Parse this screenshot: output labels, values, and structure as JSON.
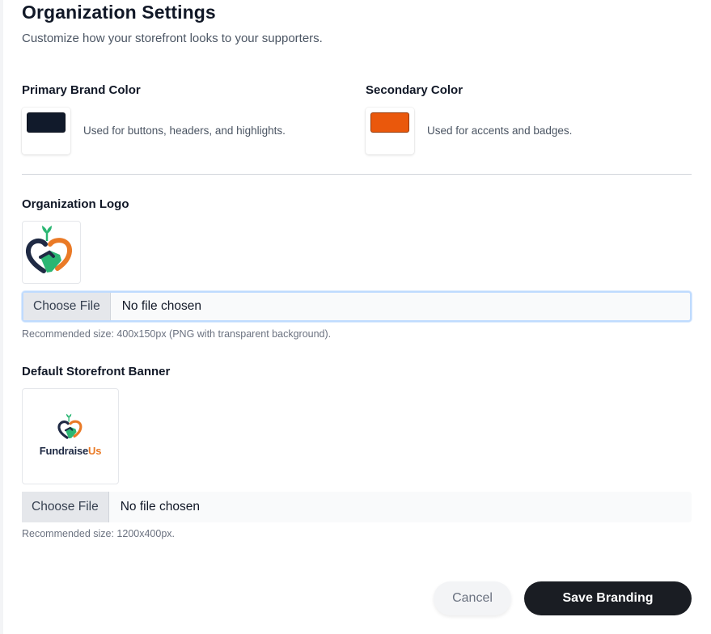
{
  "header": {
    "title": "Organization Settings",
    "subtitle": "Customize how your storefront looks to your supporters."
  },
  "colors": {
    "primary": {
      "label": "Primary Brand Color",
      "value": "#111a2b",
      "help": "Used for buttons, headers, and highlights."
    },
    "secondary": {
      "label": "Secondary Color",
      "value": "#ea580c",
      "help": "Used for accents and badges."
    }
  },
  "logo": {
    "label": "Organization Logo",
    "button_label": "Choose File",
    "status": "No file chosen",
    "help": "Recommended size: 400x150px (PNG with transparent background)."
  },
  "banner": {
    "label": "Default Storefront Banner",
    "brand_part1": "Fundraise",
    "brand_part2": "Us",
    "button_label": "Choose File",
    "status": "No file chosen",
    "help": "Recommended size: 1200x400px."
  },
  "actions": {
    "cancel_label": "Cancel",
    "save_label": "Save Branding"
  },
  "brand_colors": {
    "navy": "#1f2a44",
    "green": "#2bb673",
    "orange": "#ea7a26"
  },
  "icons": [
    "fundraiseus-logo-icon"
  ]
}
